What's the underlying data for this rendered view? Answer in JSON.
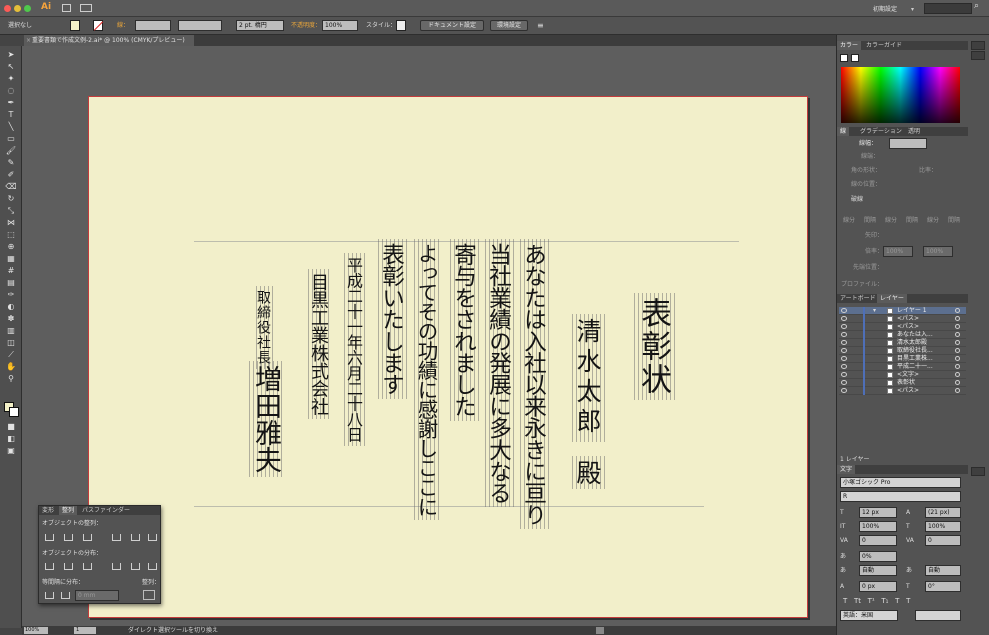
{
  "menubar": {
    "app_logo": "Ai",
    "workspace": "初期設定",
    "search_icon": "search-icon"
  },
  "control_bar": {
    "selection_label": "選択なし",
    "stroke_label": "線：",
    "brush_value": "2 pt. 楕円",
    "opacity_label": "不透明度：",
    "opacity_value": "100%",
    "style_label": "スタイル：",
    "doc_setup": "ドキュメント設定",
    "prefs": "環境設定"
  },
  "document_tab": {
    "title": "重要書類で作成文例-2.ai* @ 100% (CMYK/プレビュー)"
  },
  "status_bar": {
    "zoom": "100%",
    "page": "1",
    "message": "ダイレクト選択ツールを切り換え"
  },
  "artwork": {
    "title": "表彰状",
    "recipient": "清水太郎",
    "honorific": "殿",
    "body_lines": [
      "あなたは入社以来永きに亘り",
      "当社業績の発展に多大なる",
      "寄与をされました",
      "よってその功績に感謝しここに",
      "表彰いたします"
    ],
    "date": "平成二十一年六月二十八日",
    "company": "目黒工業株式会社",
    "position": "取締役社長",
    "president": "増田雅夫"
  },
  "color_panel": {
    "tabs": [
      "カラー",
      "カラーガイド"
    ]
  },
  "stroke_panel": {
    "tabs": [
      "線",
      "グラデーション",
      "透明"
    ],
    "weight_label": "線幅：",
    "cap_label": "線端：",
    "corner_label": "角の形状：",
    "limit_label": "比率：",
    "align_label": "線の位置：",
    "dashed_label": "破線",
    "dash_labels": [
      "線分",
      "間隔",
      "線分",
      "間隔",
      "線分",
      "間隔"
    ],
    "arrow_label": "矢印：",
    "scale_label": "倍率：",
    "scale_value": "100%",
    "align_arrow_label": "先端位置：",
    "profile_label": "プロファイル："
  },
  "layers_panel": {
    "tabs": [
      "アートボード",
      "レイヤー"
    ],
    "layers": [
      {
        "name": "レイヤー 1",
        "selected": true
      },
      {
        "name": "<パス>"
      },
      {
        "name": "<パス>"
      },
      {
        "name": "あなたは入..."
      },
      {
        "name": "清水太郎殿"
      },
      {
        "name": "取締役社長..."
      },
      {
        "name": "目黒工業株..."
      },
      {
        "name": "平成二十一..."
      },
      {
        "name": "<文字>"
      },
      {
        "name": "表彰状"
      },
      {
        "name": "<パス>"
      }
    ],
    "footer": "1 レイヤー"
  },
  "character_panel": {
    "tab": "文字",
    "font_family": "小塚ゴシック Pro",
    "font_style": "R",
    "font_size": "12 px",
    "leading": "(21 px)",
    "vscale": "100%",
    "hscale": "100%",
    "kerning": "0",
    "tracking": "0",
    "tsume": "0%",
    "aki_left": "自動",
    "aki_right": "自動",
    "baseline": "0 px",
    "rotation": "0°",
    "language": "英語：米国"
  },
  "align_panel": {
    "tabs": [
      "変形",
      "整列",
      "パスファインダー"
    ],
    "align_objects_label": "オブジェクトの整列：",
    "distribute_label": "オブジェクトの分布：",
    "spacing_label": "等間隔に分布：",
    "align_to_label": "整列：",
    "spacing_value": "0 mm"
  },
  "colors": {
    "ui_dark": "#535353",
    "artboard": "#f2efca",
    "artboard_border": "#c43c3c",
    "selection": "#5c6f8f",
    "opacity_label": "#e8a53b"
  }
}
